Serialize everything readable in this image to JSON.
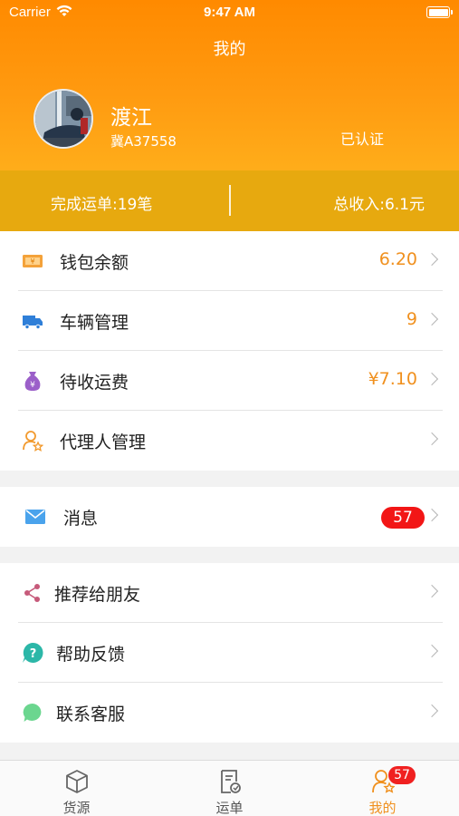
{
  "status_bar": {
    "carrier": "Carrier",
    "time": "9:47 AM"
  },
  "header": {
    "title": "我的"
  },
  "profile": {
    "name": "渡江",
    "plate": "冀A37558",
    "verified": "已认证"
  },
  "stats": {
    "completed": "完成运单:19笔",
    "income": "总收入:6.1元"
  },
  "menu_main": [
    {
      "label": "钱包余额",
      "value": "6.20",
      "icon": "wallet-icon"
    },
    {
      "label": "车辆管理",
      "value": "9",
      "icon": "truck-icon"
    },
    {
      "label": "待收运费",
      "value": "¥7.10",
      "icon": "money-bag-icon"
    },
    {
      "label": "代理人管理",
      "value": "",
      "icon": "agent-icon"
    }
  ],
  "messages": {
    "label": "消息",
    "badge": "57",
    "icon": "envelope-icon"
  },
  "menu_more": [
    {
      "label": "推荐给朋友",
      "icon": "share-icon"
    },
    {
      "label": "帮助反馈",
      "icon": "help-icon"
    },
    {
      "label": "联系客服",
      "icon": "chat-icon"
    }
  ],
  "tabbar": {
    "tabs": [
      {
        "label": "货源",
        "icon": "box-icon",
        "active": false
      },
      {
        "label": "运单",
        "icon": "waybill-icon",
        "active": false
      },
      {
        "label": "我的",
        "icon": "user-icon",
        "active": true,
        "badge": "57"
      }
    ]
  },
  "colors": {
    "header_orange": "#ff8a00",
    "stats_bar": "#e7a90f",
    "accent": "#f0901e",
    "badge_red": "#f21616"
  }
}
